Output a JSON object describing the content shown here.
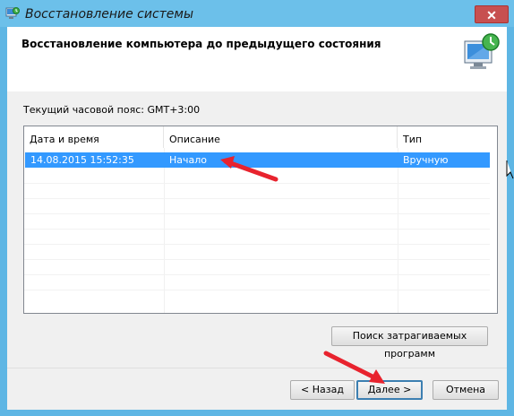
{
  "window": {
    "title": "Восстановление системы",
    "close_label": "✕"
  },
  "header": {
    "title": "Восстановление компьютера до предыдущего состояния"
  },
  "timezone_label": "Текущий часовой пояс: GMT+3:00",
  "table": {
    "columns": [
      "Дата и время",
      "Описание",
      "Тип"
    ],
    "rows": [
      {
        "date": "14.08.2015 15:52:35",
        "description": "Начало",
        "type": "Вручную",
        "selected": true
      }
    ]
  },
  "buttons": {
    "find_programs": "Поиск затрагиваемых программ",
    "back": "< Назад",
    "next": "Далее >",
    "cancel": "Отмена"
  },
  "icons": {
    "app": "system-restore-icon",
    "header": "system-restore-monitor-icon"
  },
  "colors": {
    "titlebar": "#6cc0ea",
    "close": "#c75050",
    "selection": "#3399ff",
    "annotation_arrow": "#e8232e"
  }
}
